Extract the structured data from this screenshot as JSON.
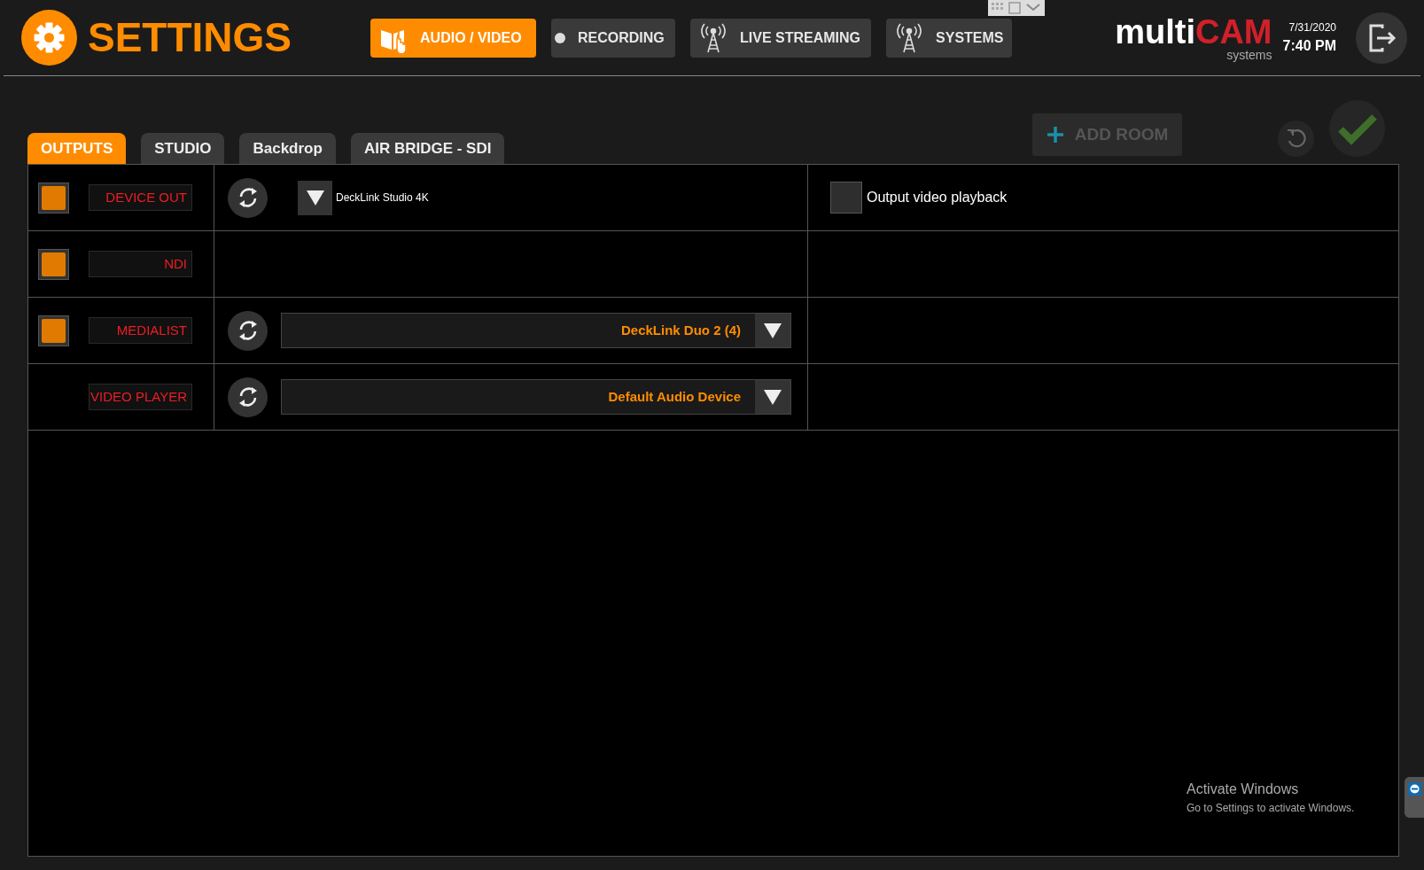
{
  "header": {
    "title": "SETTINGS",
    "nav": [
      {
        "label": "AUDIO / VIDEO",
        "kind": "book",
        "selected": true
      },
      {
        "label": "RECORDING",
        "kind": "dot",
        "selected": false
      },
      {
        "label": "LIVE STREAMING",
        "kind": "antenna",
        "selected": false
      },
      {
        "label": "SYSTEMS",
        "kind": "antenna",
        "selected": false
      }
    ],
    "brand": {
      "part_a": "multi",
      "part_b": "CAM",
      "tagline": "systems"
    },
    "date": "7/31/2020",
    "time": "7:40 PM"
  },
  "tabs": [
    {
      "label": "OUTPUTS",
      "selected": true
    },
    {
      "label": "STUDIO",
      "selected": false
    },
    {
      "label": "Backdrop",
      "selected": false
    },
    {
      "label": "AIR BRIDGE - SDI",
      "selected": false
    }
  ],
  "add_room": {
    "label": "ADD ROOM",
    "disabled": true
  },
  "outputs": [
    {
      "label": "DEVICE OUT",
      "checked": true,
      "device": {
        "kind": "compact",
        "value": "DeckLink Studio 4K"
      },
      "option": {
        "label": "Output video playback",
        "checked": false
      }
    },
    {
      "label": "NDI",
      "checked": true,
      "device": {
        "kind": "none"
      }
    },
    {
      "label": "MEDIALIST",
      "checked": true,
      "device": {
        "kind": "combo",
        "value": "DeckLink Duo 2 (4)"
      }
    },
    {
      "label": "VIDEO PLAYER",
      "device": {
        "kind": "combo",
        "value": "Default Audio Device"
      }
    }
  ],
  "os_notice": {
    "title": "Activate Windows",
    "text": "Go to Settings to activate Windows."
  }
}
